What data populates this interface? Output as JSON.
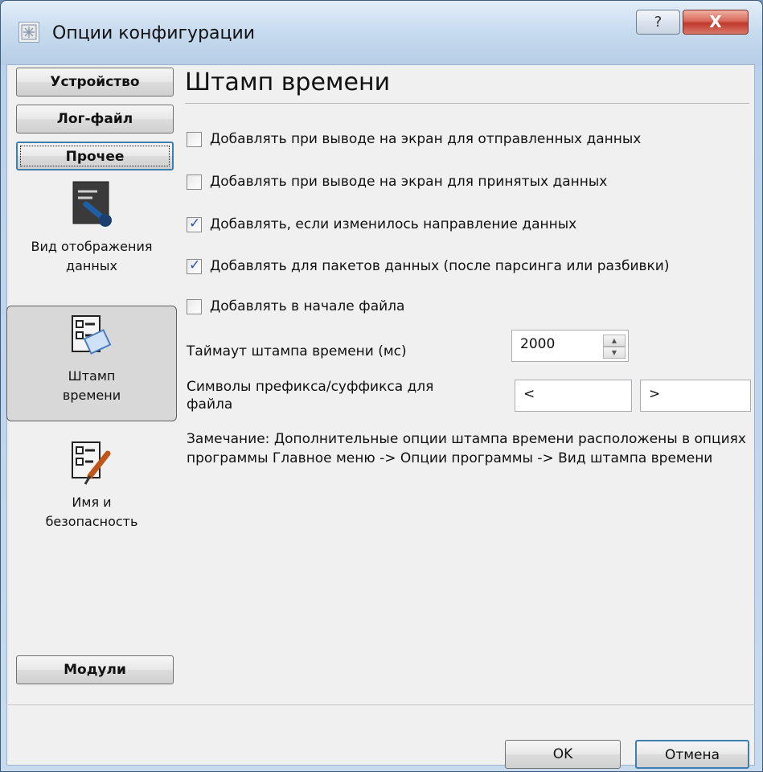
{
  "window": {
    "title": "Опции конфигурации",
    "help_glyph": "?",
    "close_glyph": "X"
  },
  "nav": {
    "buttons": [
      {
        "label": "Устройство"
      },
      {
        "label": "Лог-файл"
      },
      {
        "label": "Прочее"
      }
    ],
    "tiles": [
      {
        "label": "Вид отображения данных",
        "icon": "display-view-icon"
      },
      {
        "label": "Штамп времени",
        "icon": "timestamp-ok-icon",
        "selected": true
      },
      {
        "label": "Имя и безопасность",
        "icon": "name-security-icon"
      }
    ],
    "modules_label": "Модули"
  },
  "main": {
    "heading": "Штамп времени",
    "checkboxes": [
      {
        "label": "Добавлять при выводе на экран для отправленных данных",
        "checked": false
      },
      {
        "label": "Добавлять при выводе на экран для принятых данных",
        "checked": false
      },
      {
        "label": "Добавлять, если изменилось направление данных",
        "checked": true
      },
      {
        "label": "Добавлять для пакетов данных (после парсинга или разбивки)",
        "checked": true
      },
      {
        "label": "Добавлять в начале файла",
        "checked": false
      }
    ],
    "timeout_label": "Таймаут штампа времени (мс)",
    "timeout_value": "2000",
    "prefix_label": "Символы префикса/суффикса для файла",
    "prefix_value": "<",
    "suffix_value": ">",
    "note": "Замечание: Дополнительные опции штампа времени расположены в опциях программы Главное меню -> Опции программы -> Вид штампа времени"
  },
  "footer": {
    "ok_label": "OK",
    "cancel_label": "Отмена"
  },
  "colors": {
    "accent": "#3c7fb1",
    "check": "#2a52a8",
    "close": "#c0392b"
  }
}
